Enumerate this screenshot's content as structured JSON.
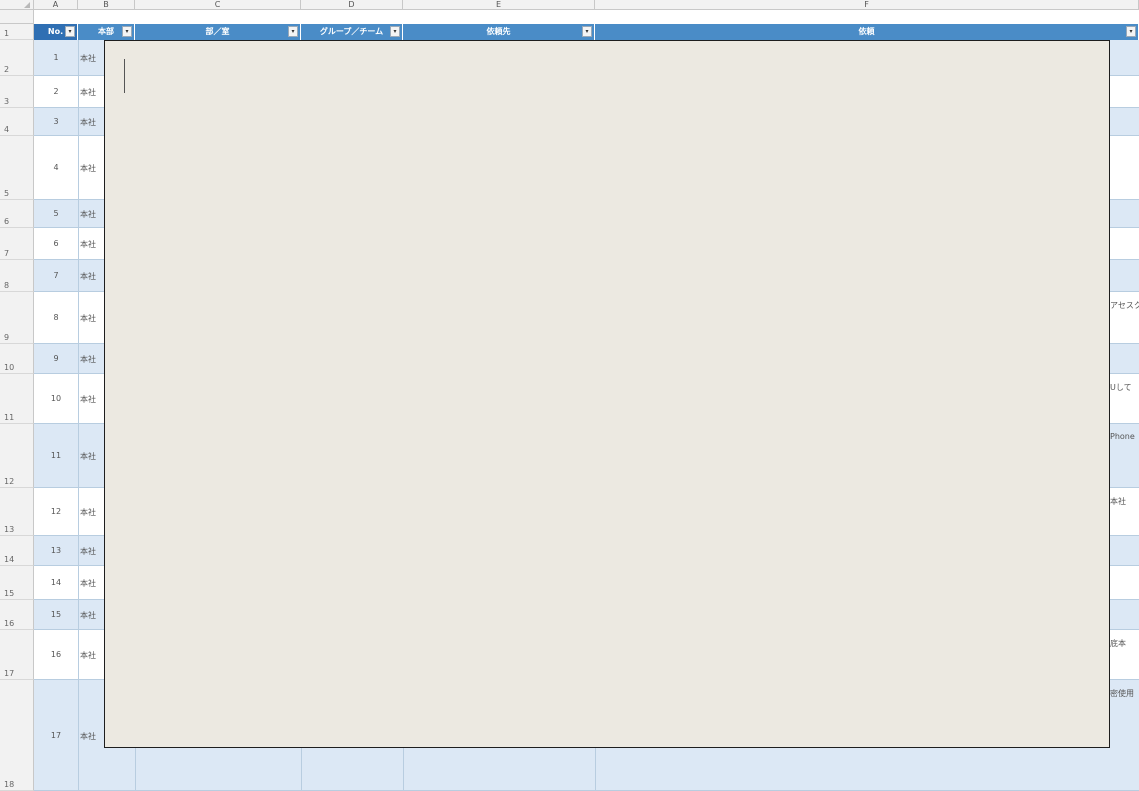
{
  "column_letters": [
    "A",
    "B",
    "C",
    "D",
    "E",
    "F"
  ],
  "header": {
    "no_label": "No.",
    "b_label": "本部",
    "c_label": "部／室",
    "d_label": "グループ／チーム",
    "e_label": "依頼先",
    "f_label": "依頼"
  },
  "rows": [
    {
      "row": "1"
    },
    {
      "row": "2",
      "no": "1",
      "b": "本社",
      "f": ""
    },
    {
      "row": "3",
      "no": "2",
      "b": "本社",
      "f": ""
    },
    {
      "row": "4",
      "no": "3",
      "b": "本社",
      "f": ""
    },
    {
      "row": "5",
      "no": "4",
      "b": "本社",
      "f": ""
    },
    {
      "row": "6",
      "no": "5",
      "b": "本社",
      "f": ""
    },
    {
      "row": "7",
      "no": "6",
      "b": "本社",
      "f": ""
    },
    {
      "row": "8",
      "no": "7",
      "b": "本社",
      "f": ""
    },
    {
      "row": "9",
      "no": "8",
      "b": "本社",
      "f": "アセスク"
    },
    {
      "row": "10",
      "no": "9",
      "b": "本社",
      "f": ""
    },
    {
      "row": "11",
      "no": "10",
      "b": "本社",
      "f": "Uして"
    },
    {
      "row": "12",
      "no": "11",
      "b": "本社",
      "f": "Phone"
    },
    {
      "row": "13",
      "no": "12",
      "b": "本社",
      "f": "本社"
    },
    {
      "row": "14",
      "no": "13",
      "b": "本社",
      "f": ""
    },
    {
      "row": "15",
      "no": "14",
      "b": "本社",
      "f": ""
    },
    {
      "row": "16",
      "no": "15",
      "b": "本社",
      "f": ""
    },
    {
      "row": "17",
      "no": "16",
      "b": "本社",
      "f": "底本"
    },
    {
      "row": "18",
      "no": "17",
      "b": "本社",
      "f": "密使用"
    }
  ],
  "colors": {
    "header_blue": "#4a8cc7",
    "band_blue": "#dce8f5",
    "editor_bg": "#ece9e1"
  },
  "icons": {
    "filter": "filter-dropdown-icon",
    "caret": "text-caret"
  }
}
